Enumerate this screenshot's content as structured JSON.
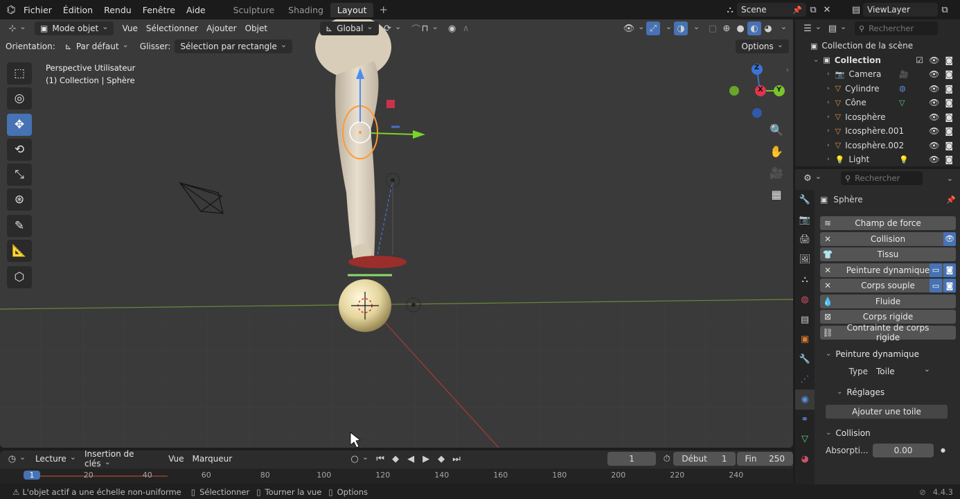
{
  "menu": [
    "Fichier",
    "Édition",
    "Rendu",
    "Fenêtre",
    "Aide"
  ],
  "workspaces": [
    {
      "label": "Sculpture",
      "active": false
    },
    {
      "label": "Shading",
      "active": false
    },
    {
      "label": "Layout",
      "active": true
    }
  ],
  "add_workspace": "+",
  "scene": "Scene",
  "view_layer": "ViewLayer",
  "viewport": {
    "mode": "Mode objet",
    "menus": [
      "Vue",
      "Sélectionner",
      "Ajouter",
      "Objet"
    ],
    "transform_orientation": "Global",
    "orientation_label": "Orientation:",
    "orientation_value": "Par défaut",
    "drag_label": "Glisser:",
    "drag_value": "Sélection par rectangle",
    "options": "Options",
    "overlay_title": "Perspective Utilisateur",
    "overlay_subtitle": "(1) Collection | Sphère",
    "gizmo": {
      "z": "Z",
      "x": "X",
      "y": "Y"
    }
  },
  "outliner": {
    "search_placeholder": "Rechercher",
    "root": "Collection de la scène",
    "collection": "Collection",
    "items": [
      "Camera",
      "Cylindre",
      "Cône",
      "Icosphère",
      "Icosphère.001",
      "Icosphère.002",
      "Light"
    ]
  },
  "properties": {
    "search_placeholder": "Rechercher",
    "object_name": "Sphère",
    "physics": [
      {
        "label": "Champ de force",
        "icon": "≋",
        "extra": []
      },
      {
        "label": "Collision",
        "icon": "✕",
        "extra": [
          "👁"
        ]
      },
      {
        "label": "Tissu",
        "icon": "👕",
        "extra": []
      },
      {
        "label": "Peinture dynamique",
        "icon": "✕",
        "extra": [
          "▭",
          "◙"
        ]
      },
      {
        "label": "Corps souple",
        "icon": "✕",
        "extra": [
          "▭",
          "◙"
        ]
      },
      {
        "label": "Fluide",
        "icon": "💧",
        "extra": []
      },
      {
        "label": "Corps rigide",
        "icon": "⊠",
        "extra": []
      },
      {
        "label": "Contrainte de corps rigide",
        "icon": "⛓",
        "extra": []
      }
    ],
    "dynamic_paint_panel": "Peinture dynamique",
    "type_label": "Type",
    "type_value": "Toile",
    "settings_panel": "Réglages",
    "add_canvas": "Ajouter une toile",
    "collision_panel": "Collision",
    "absorption_label": "Absorpti...",
    "absorption_value": "0.00"
  },
  "timeline": {
    "menus": [
      "Lecture",
      "Insertion de clés",
      "Vue",
      "Marqueur"
    ],
    "current_frame": "1",
    "start_label": "Début",
    "start_value": "1",
    "end_label": "Fin",
    "end_value": "250",
    "ruler_marks": [
      "1",
      "20",
      "40",
      "60",
      "80",
      "100",
      "120",
      "140",
      "160",
      "180",
      "200",
      "220",
      "240"
    ]
  },
  "status": {
    "warning": "L'objet actif a une échelle non-uniforme",
    "select": "Sélectionner",
    "rotate_view": "Tourner la vue",
    "options": "Options",
    "version": "4.4.3"
  }
}
